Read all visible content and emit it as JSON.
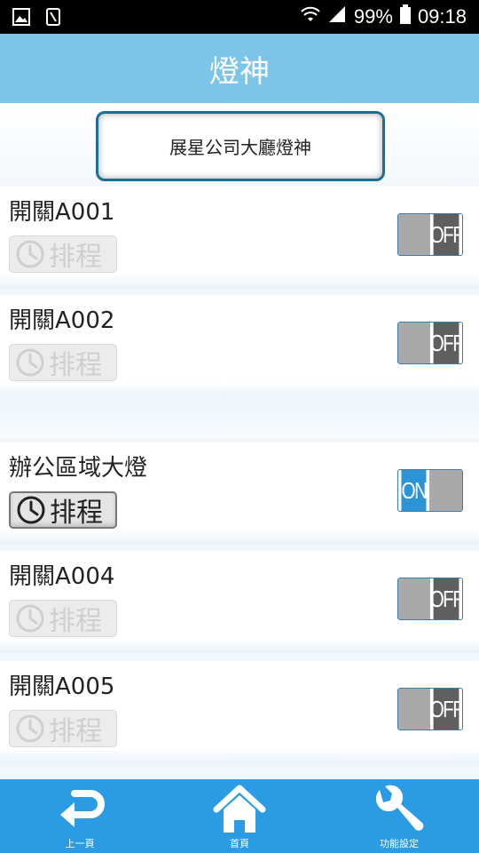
{
  "status_bar": {
    "battery": "99%",
    "time": "09:18"
  },
  "header": {
    "title": "燈神"
  },
  "location": {
    "label": "展星公司大廳燈神"
  },
  "switches": [
    {
      "name": "開關A001",
      "schedule_label": "排程",
      "state_label": "OFF",
      "on": false
    },
    {
      "name": "開關A002",
      "schedule_label": "排程",
      "state_label": "OFF",
      "on": false
    },
    {
      "name": "辦公區域大燈",
      "schedule_label": "排程",
      "state_label": "ON",
      "on": true
    },
    {
      "name": "開關A004",
      "schedule_label": "排程",
      "state_label": "OFF",
      "on": false
    },
    {
      "name": "開關A005",
      "schedule_label": "排程",
      "state_label": "OFF",
      "on": false
    }
  ],
  "bottom_nav": {
    "back": {
      "label": "上一頁",
      "icon": "back-arrow-icon"
    },
    "home": {
      "label": "首頁",
      "icon": "home-icon"
    },
    "settings": {
      "label": "功能設定",
      "icon": "wrench-icon"
    }
  },
  "colors": {
    "header": "#7cc5e9",
    "nav": "#2b9be3",
    "toggle_on": "#2b93d6",
    "toggle_off": "#5f5f5f"
  }
}
